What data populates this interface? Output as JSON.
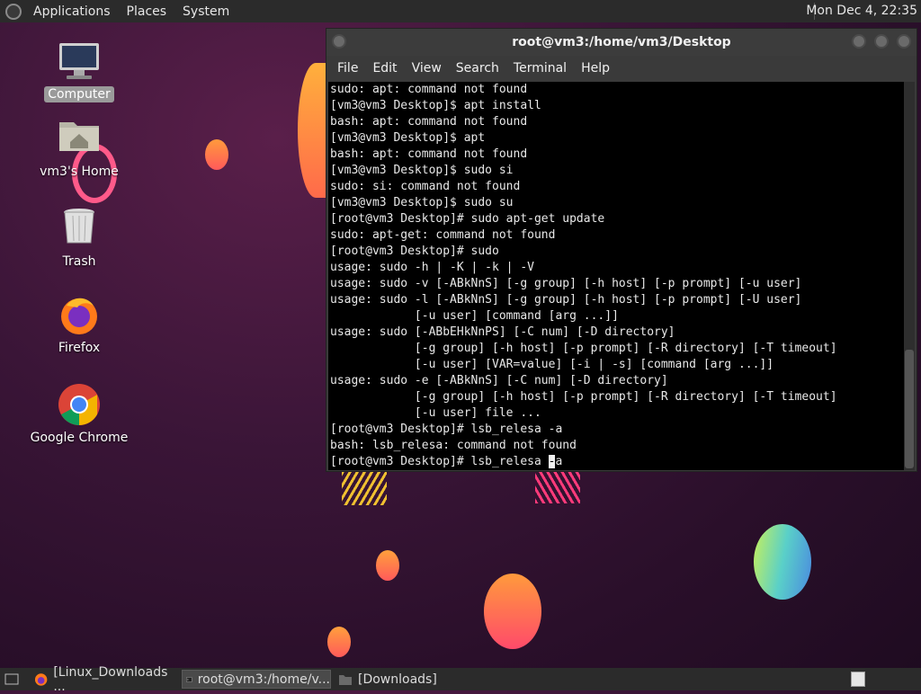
{
  "top_panel": {
    "menus": [
      "Applications",
      "Places",
      "System"
    ],
    "clock": "Mon Dec  4, 22:35"
  },
  "desktop_icons": [
    {
      "label": "Computer",
      "icon": "computer-icon"
    },
    {
      "label": "vm3's Home",
      "icon": "home-folder-icon"
    },
    {
      "label": "Trash",
      "icon": "trash-icon"
    },
    {
      "label": "Firefox",
      "icon": "firefox-icon"
    },
    {
      "label": "Google Chrome",
      "icon": "chrome-icon"
    }
  ],
  "terminal": {
    "title": "root@vm3:/home/vm3/Desktop",
    "menu": [
      "File",
      "Edit",
      "View",
      "Search",
      "Terminal",
      "Help"
    ],
    "lines": [
      "sudo: apt: command not found",
      "[vm3@vm3 Desktop]$ apt install",
      "bash: apt: command not found",
      "[vm3@vm3 Desktop]$ apt",
      "bash: apt: command not found",
      "[vm3@vm3 Desktop]$ sudo si",
      "sudo: si: command not found",
      "[vm3@vm3 Desktop]$ sudo su",
      "[root@vm3 Desktop]# sudo apt-get update",
      "sudo: apt-get: command not found",
      "[root@vm3 Desktop]# sudo",
      "usage: sudo -h | -K | -k | -V",
      "usage: sudo -v [-ABkNnS] [-g group] [-h host] [-p prompt] [-u user]",
      "usage: sudo -l [-ABkNnS] [-g group] [-h host] [-p prompt] [-U user]",
      "            [-u user] [command [arg ...]]",
      "usage: sudo [-ABbEHkNnPS] [-C num] [-D directory]",
      "            [-g group] [-h host] [-p prompt] [-R directory] [-T timeout]",
      "            [-u user] [VAR=value] [-i | -s] [command [arg ...]]",
      "usage: sudo -e [-ABkNnS] [-C num] [-D directory]",
      "            [-g group] [-h host] [-p prompt] [-R directory] [-T timeout]",
      "            [-u user] file ...",
      "[root@vm3 Desktop]# lsb_relesa -a",
      "bash: lsb_relesa: command not found"
    ],
    "prompt_before_cursor": "[root@vm3 Desktop]# lsb_relesa ",
    "cursor_char": "-",
    "prompt_after_cursor": "a"
  },
  "taskbar": {
    "items": [
      {
        "label": "[Linux_Downloads ...",
        "icon": "firefox-icon"
      },
      {
        "label": "root@vm3:/home/v...",
        "icon": "terminal-icon"
      },
      {
        "label": "[Downloads]",
        "icon": "folder-icon"
      }
    ]
  }
}
